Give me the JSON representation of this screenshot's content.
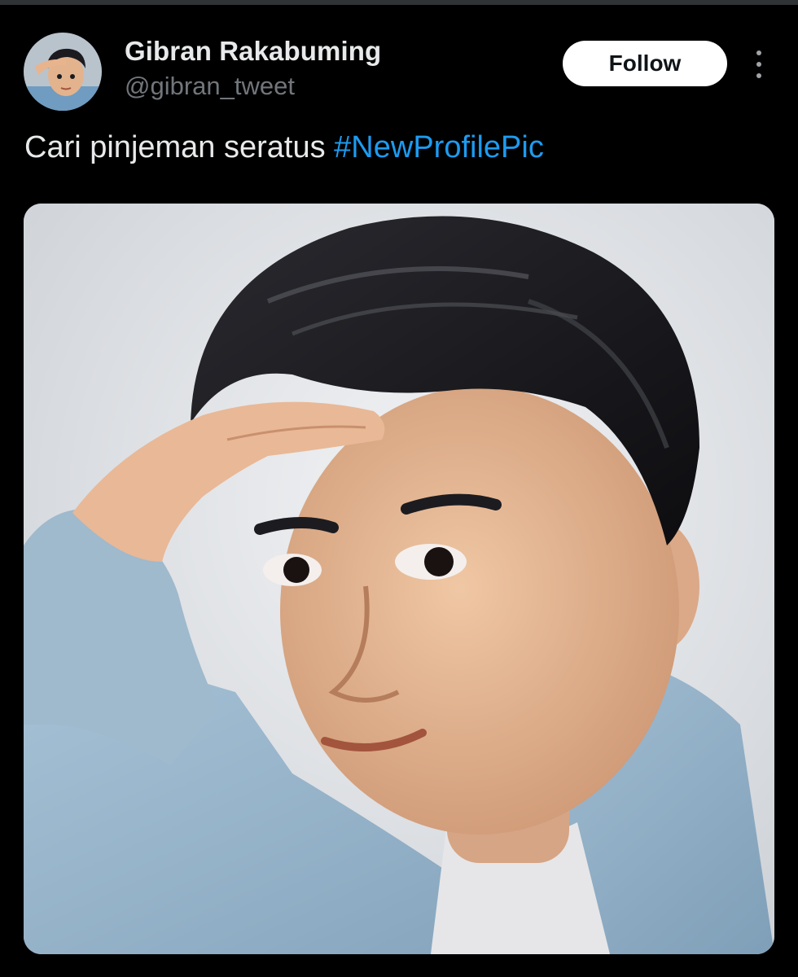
{
  "tweet": {
    "author_name": "Gibran Rakabuming",
    "author_handle": "@gibran_tweet",
    "follow_label": "Follow",
    "text": "Cari pinjeman seratus ",
    "hashtag": "#NewProfilePic"
  },
  "icons": {
    "more": "more-options-icon"
  },
  "colors": {
    "background": "#000000",
    "link": "#1d9bf0",
    "follow_button_bg": "#ffffff",
    "secondary_text": "#71767b"
  }
}
